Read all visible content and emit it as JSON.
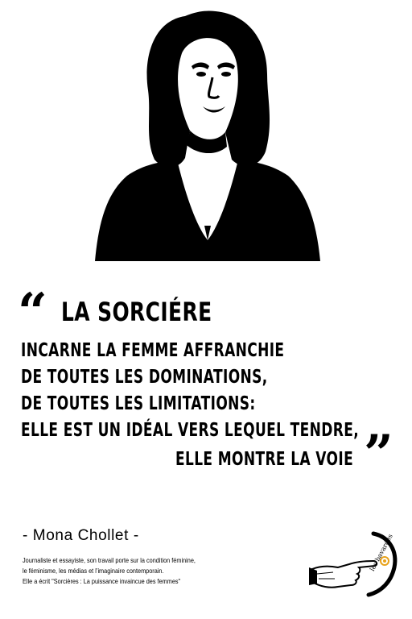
{
  "quote": {
    "open_mark": "“",
    "close_mark": "”",
    "line1": "LA SORCIÉRE",
    "line2": "INCARNE LA FEMME AFFRANCHIE",
    "line3": "DE TOUTES LES DOMINATIONS,",
    "line4": "DE TOUTES LES LIMITATIONS:",
    "line5": "ELLE EST UN IDÉAL VERS LEQUEL TENDRE,",
    "line6": "ELLE MONTRE LA VOIE"
  },
  "author": {
    "name": "- Mona Chollet -",
    "bio_line1": "Journaliste et essayiste, son travail porte sur la condition féminine,",
    "bio_line2": "le féminisme, les médias et l’imaginaire contemporain.",
    "bio_line3": "Elle a écrit \"Sorcières : La puissance invaincue des femmes\""
  },
  "logo": {
    "text": "les bavardes",
    "accent_color": "#e8a21a"
  },
  "colors": {
    "ink": "#000000",
    "background": "#ffffff"
  }
}
